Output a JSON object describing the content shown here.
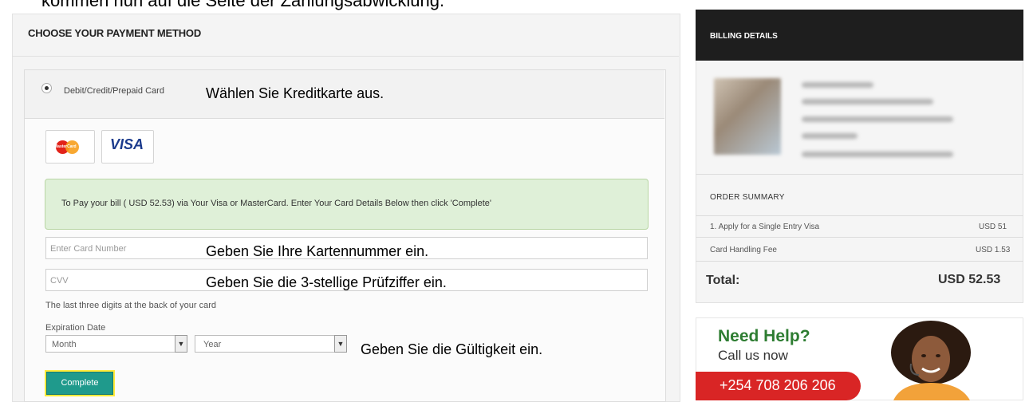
{
  "annotations": {
    "top_caption": "kommen nun auf die Seite der Zahlungsabwicklung.",
    "select_card": "Wählen Sie Kreditkarte aus.",
    "enter_number": "Geben Sie Ihre Kartennummer ein.",
    "enter_cvv": "Geben Sie die 3-stellige Prüfziffer ein.",
    "enter_expiry": "Geben Sie die Gültigkeit ein."
  },
  "payment": {
    "heading": "CHOOSE YOUR PAYMENT METHOD",
    "option_label": "Debit/Credit/Prepaid Card",
    "mastercard_text": "MasterCard",
    "visa_text": "VISA",
    "info_text": "To Pay your bill ( USD 52.53) via Your Visa or MasterCard. Enter Your Card Details Below then click 'Complete'",
    "card_number_placeholder": "Enter Card Number",
    "cvv_placeholder": "CVV",
    "cvv_help": "The last three digits at the back of your card",
    "expiration_label": "Expiration Date",
    "month_value": "Month",
    "year_value": "Year",
    "complete_label": "Complete"
  },
  "billing": {
    "title": "BILLING DETAILS"
  },
  "order": {
    "title": "ORDER SUMMARY",
    "items": [
      {
        "label": "1. Apply for a Single Entry Visa",
        "amount": "USD 51"
      },
      {
        "label": "Card Handling Fee",
        "amount": "USD 1.53"
      }
    ],
    "total_label": "Total:",
    "total_value": "USD 52.53"
  },
  "help": {
    "need_help": "Need Help?",
    "call_us": "Call us now",
    "phone": "+254 708 206 206"
  },
  "colors": {
    "accent_green": "#1f9a8c",
    "info_bg": "#dff0d8",
    "banner_red": "#d92525",
    "header_dark": "#1e1e1e",
    "highlight_yellow": "#ffeb3b"
  }
}
